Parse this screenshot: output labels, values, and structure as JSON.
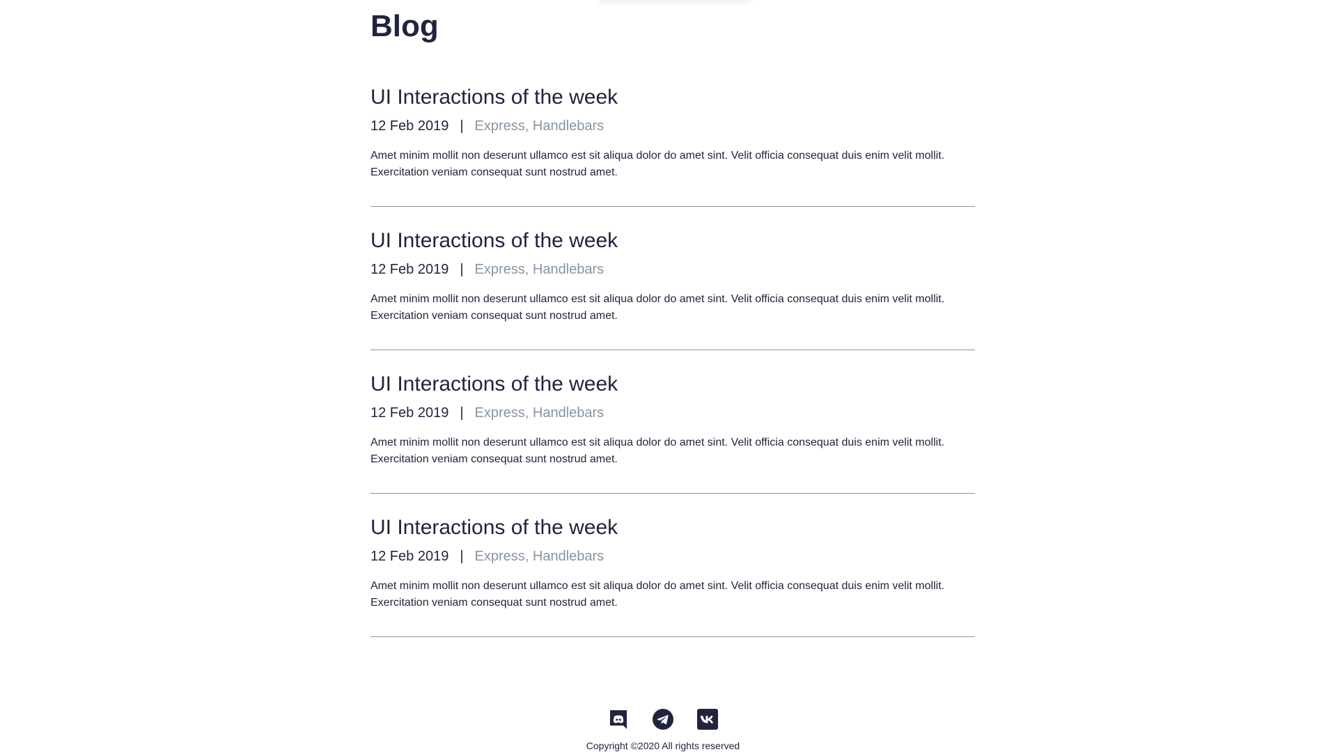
{
  "page": {
    "title": "Blog"
  },
  "posts": [
    {
      "title": "UI Interactions of the week",
      "date": "12 Feb 2019",
      "separator": "|",
      "tags": "Express, Handlebars",
      "excerpt": "Amet minim mollit non deserunt ullamco est sit aliqua dolor do amet sint. Velit officia consequat duis enim velit mollit. Exercitation veniam consequat sunt nostrud amet."
    },
    {
      "title": "UI Interactions of the week",
      "date": "12 Feb 2019",
      "separator": "|",
      "tags": "Express, Handlebars",
      "excerpt": "Amet minim mollit non deserunt ullamco est sit aliqua dolor do amet sint. Velit officia consequat duis enim velit mollit. Exercitation veniam consequat sunt nostrud amet."
    },
    {
      "title": "UI Interactions of the week",
      "date": "12 Feb 2019",
      "separator": "|",
      "tags": "Express, Handlebars",
      "excerpt": "Amet minim mollit non deserunt ullamco est sit aliqua dolor do amet sint. Velit officia consequat duis enim velit mollit. Exercitation veniam consequat sunt nostrud amet."
    },
    {
      "title": "UI Interactions of the week",
      "date": "12 Feb 2019",
      "separator": "|",
      "tags": "Express, Handlebars",
      "excerpt": "Amet minim mollit non deserunt ullamco est sit aliqua dolor do amet sint. Velit officia consequat duis enim velit mollit. Exercitation veniam consequat sunt nostrud amet."
    }
  ],
  "footer": {
    "socials": [
      {
        "icon": "discord-icon"
      },
      {
        "icon": "telegram-icon"
      },
      {
        "icon": "vk-icon"
      }
    ],
    "copyright": "Copyright ©2020 All rights reserved"
  },
  "colors": {
    "text": "#21243d",
    "muted": "#8695a4",
    "background": "#ffffff"
  }
}
